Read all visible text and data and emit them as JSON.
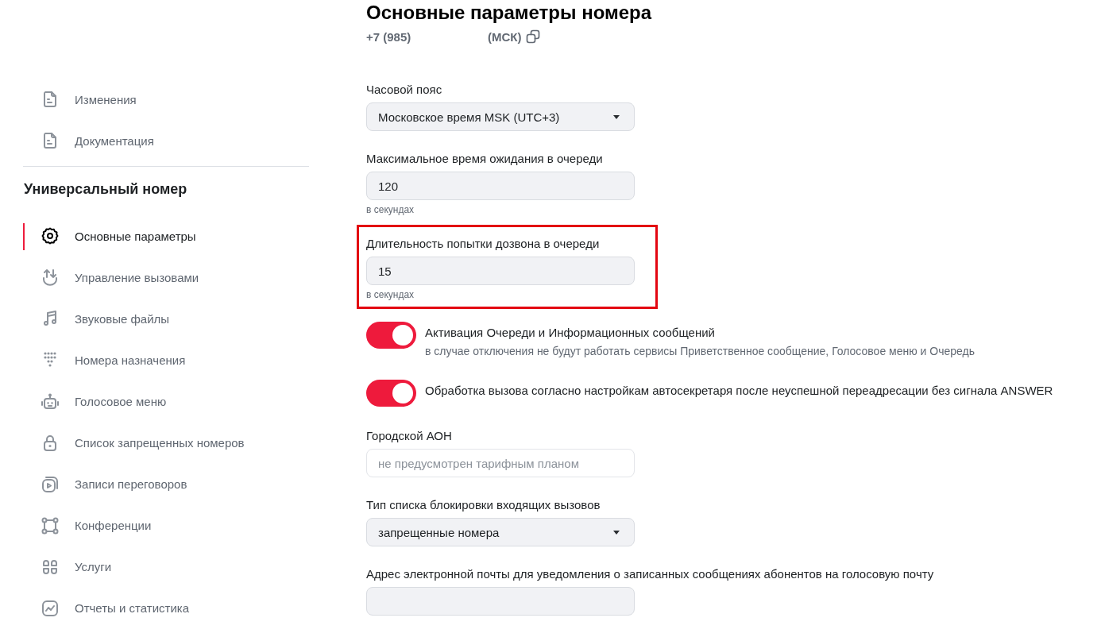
{
  "page": {
    "title": "Основные параметры номера",
    "phone": "+7 (985)",
    "region": "(МСК)"
  },
  "sidebar": {
    "top_items": [
      {
        "label": "Изменения",
        "selected": false
      },
      {
        "label": "Документация",
        "selected": false
      }
    ],
    "section": {
      "title": "Универсальный номер",
      "items": [
        {
          "label": "Основные параметры",
          "selected": true
        },
        {
          "label": "Управление вызовами",
          "selected": false
        },
        {
          "label": "Звуковые файлы",
          "selected": false
        },
        {
          "label": "Номера назначения",
          "selected": false
        },
        {
          "label": "Голосовое меню",
          "selected": false
        },
        {
          "label": "Список запрещенных номеров",
          "selected": false
        },
        {
          "label": "Записи переговоров",
          "selected": false
        },
        {
          "label": "Конференции",
          "selected": false
        },
        {
          "label": "Услуги",
          "selected": false
        },
        {
          "label": "Отчеты и статистика",
          "selected": false
        }
      ]
    }
  },
  "form": [
    {
      "kind": "select",
      "label": "Часовой пояс",
      "value": "Московское время MSK (UTC+3)"
    },
    {
      "kind": "input",
      "label": "Максимальное время ожидания в очереди",
      "value": "120",
      "hint": "в секундах"
    },
    {
      "kind": "input",
      "label": "Длительность попытки дозвона в очереди",
      "value": "15",
      "hint": "в секундах",
      "highlighted": true
    },
    {
      "kind": "toggle",
      "label": "Активация Очереди и Информационных сообщений",
      "description": "в случае отключения не будут работать сервисы Приветственное сообщение, Голосовое меню и Очередь",
      "on": true
    },
    {
      "kind": "toggle",
      "label": "Обработка вызова согласно настройкам автосекретаря после неуспешной переадресации без сигнала ANSWER",
      "on": true
    },
    {
      "kind": "input",
      "label": "Городской АОН",
      "placeholder": "не предусмотрен тарифным планом",
      "disabled": true
    },
    {
      "kind": "select",
      "label": "Тип списка блокировки входящих вызовов",
      "value": "запрещенные номера"
    },
    {
      "kind": "input",
      "label": "Адрес электронной почты для уведомления о записанных сообщениях абонентов на голосовую почту"
    }
  ]
}
